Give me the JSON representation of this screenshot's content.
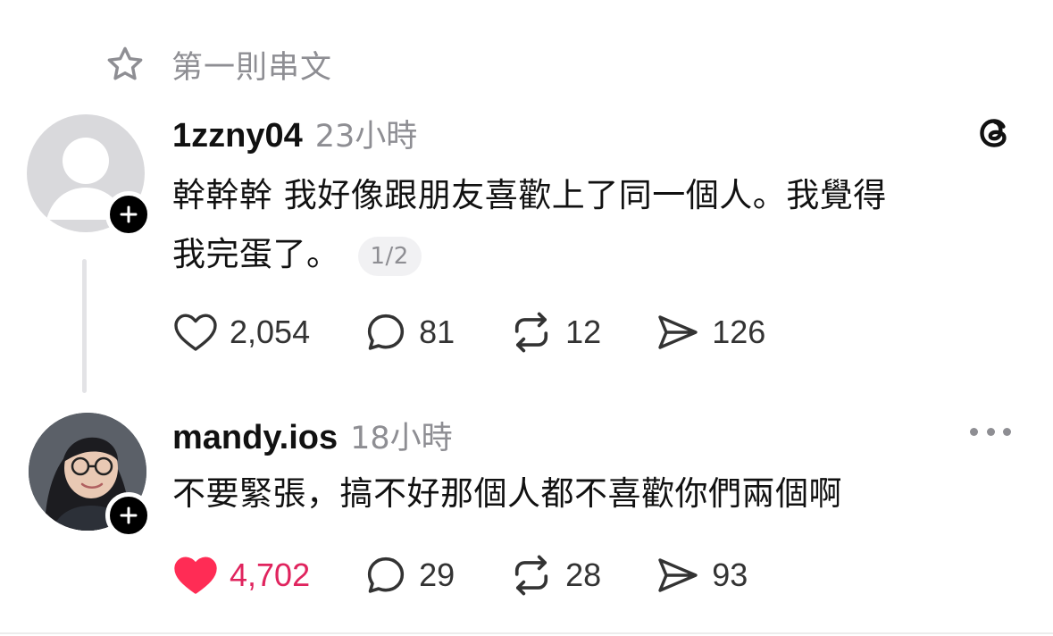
{
  "pinned": {
    "label": "第一則串文",
    "icon": "star-icon"
  },
  "posts": [
    {
      "username": "1zzny04",
      "time": "23小時",
      "text_line1": "幹幹幹 我好像跟朋友喜歡上了同一個人。我覺得",
      "text_line2": "我完蛋了。",
      "page_indicator": "1/2",
      "likes": "2,054",
      "comments": "81",
      "reposts": "12",
      "shares": "126",
      "liked": false
    },
    {
      "username": "mandy.ios",
      "time": "18小時",
      "text": "不要緊張，搞不好那個人都不喜歡你們兩個啊",
      "likes": "4,702",
      "comments": "29",
      "reposts": "28",
      "shares": "93",
      "liked": true
    }
  ],
  "colors": {
    "like_active": "#ff2c55",
    "muted": "#8e8e93"
  }
}
